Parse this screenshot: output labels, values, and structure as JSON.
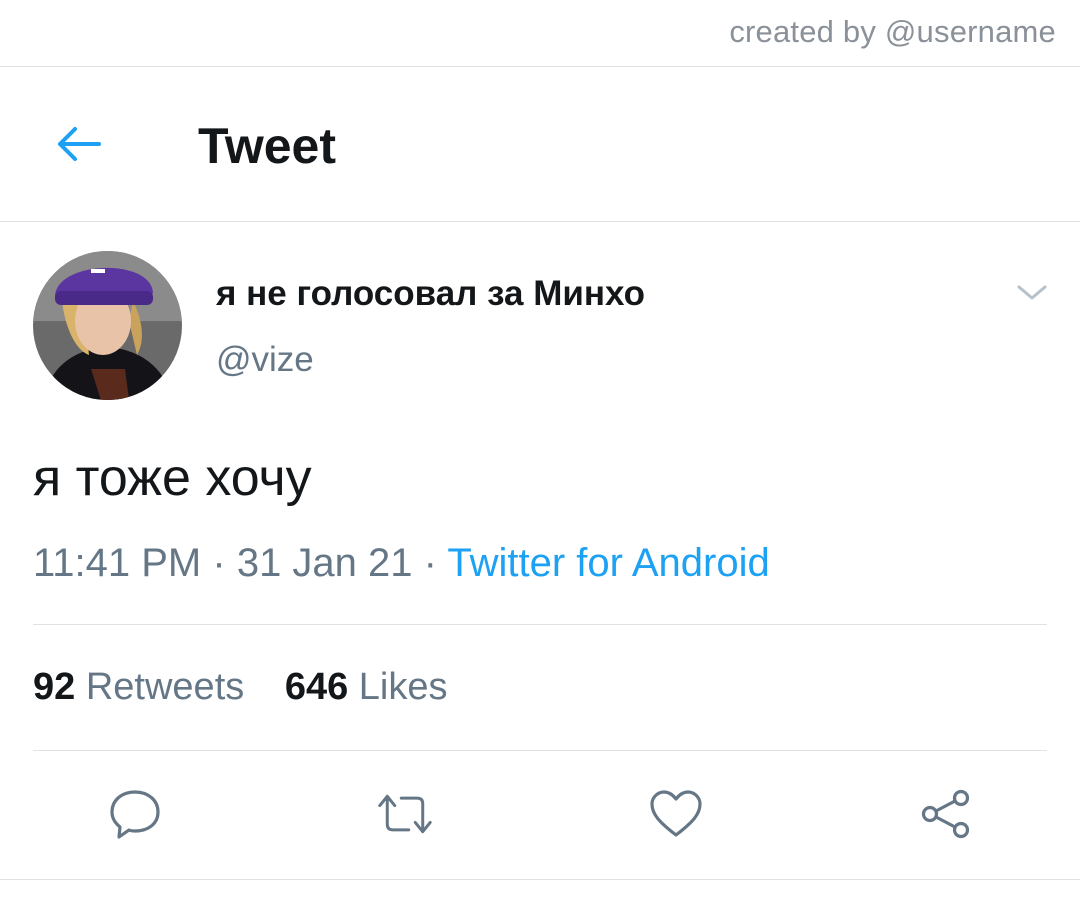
{
  "watermark": "created by @username",
  "header": {
    "title": "Tweet",
    "back_icon": "arrow-left-icon",
    "accent_color": "#1da1f2"
  },
  "tweet": {
    "display_name": "я не голосовал за Минхо",
    "handle": "@vize",
    "text": "я тоже хочу",
    "time": "11:41 PM",
    "date": "31 Jan 21",
    "separator": "·",
    "source": "Twitter for Android",
    "menu_icon": "chevron-down-icon"
  },
  "stats": {
    "retweets_count": "92",
    "retweets_label": "Retweets",
    "likes_count": "646",
    "likes_label": "Likes"
  },
  "actions": {
    "reply_icon": "reply-icon",
    "retweet_icon": "retweet-icon",
    "like_icon": "heart-icon",
    "share_icon": "share-icon",
    "icon_color": "#657786"
  }
}
